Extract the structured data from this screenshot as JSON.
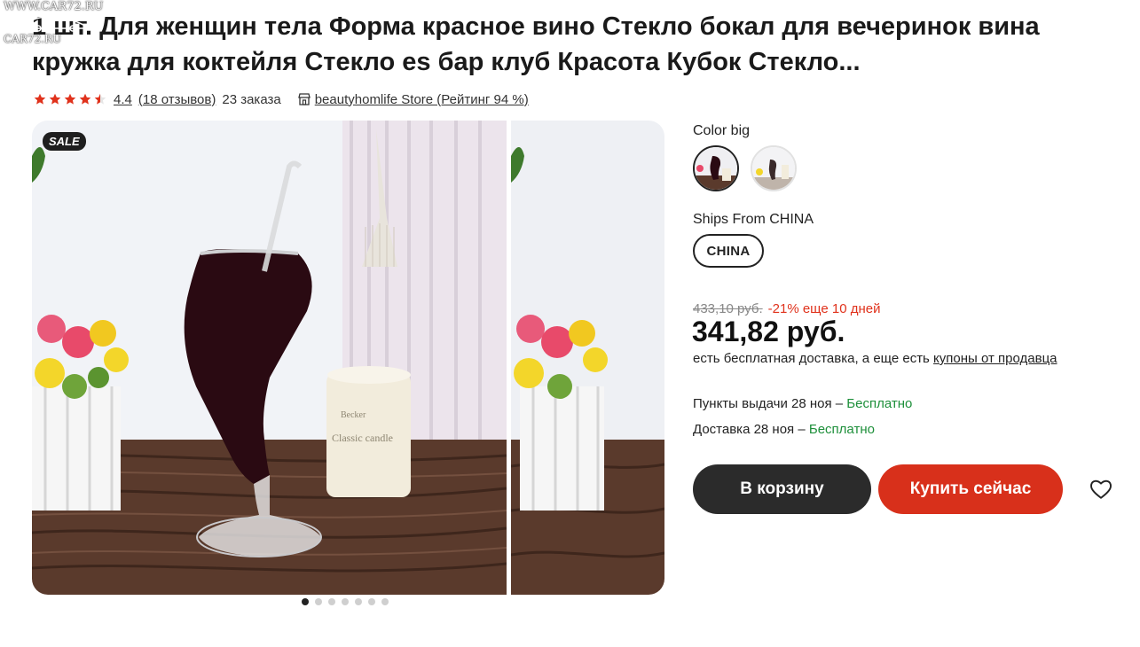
{
  "watermark": {
    "line1": "WWW.CAR72.RU",
    "line2": "CAR72.RU"
  },
  "product": {
    "title": "1 шт. Для женщин тела Форма красное вино Стекло бокал для вечеринок вина кружка для коктейля Стекло es бар клуб Красота Кубок Стекло..."
  },
  "rating": {
    "value": "4.4",
    "stars": 4.5,
    "reviews": "(18 отзывов)",
    "orders": "23 заказа",
    "store": "beautyhomlife Store (Рейтинг 94 %)"
  },
  "gallery": {
    "badge": "SALE",
    "candle_text1": "Becker",
    "candle_text2": "Classic candle",
    "slide_count": 7,
    "active_slide": 0
  },
  "options": {
    "color_label": "Color big",
    "ships_label": "Ships From CHINA",
    "ships_value": "CHINA"
  },
  "pricing": {
    "old_price": "433,10 руб.",
    "discount": "-21% еще 10 дней",
    "price": "341,82 руб.",
    "shipping_note": "есть бесплатная доставка, а еще есть ",
    "coupons_link": "купоны от продавца"
  },
  "delivery": {
    "pickup_text": "Пункты выдачи 28 ноя – ",
    "pickup_free": "Бесплатно",
    "courier_text": "Доставка 28 ноя – ",
    "courier_free": "Бесплатно"
  },
  "actions": {
    "cart_label": "В корзину",
    "buy_label": "Купить сейчас"
  },
  "colors": {
    "accent": "#d8301b",
    "dark_button": "#2b2b2b",
    "star": "#e0321c",
    "free_green": "#1d8f3a"
  }
}
